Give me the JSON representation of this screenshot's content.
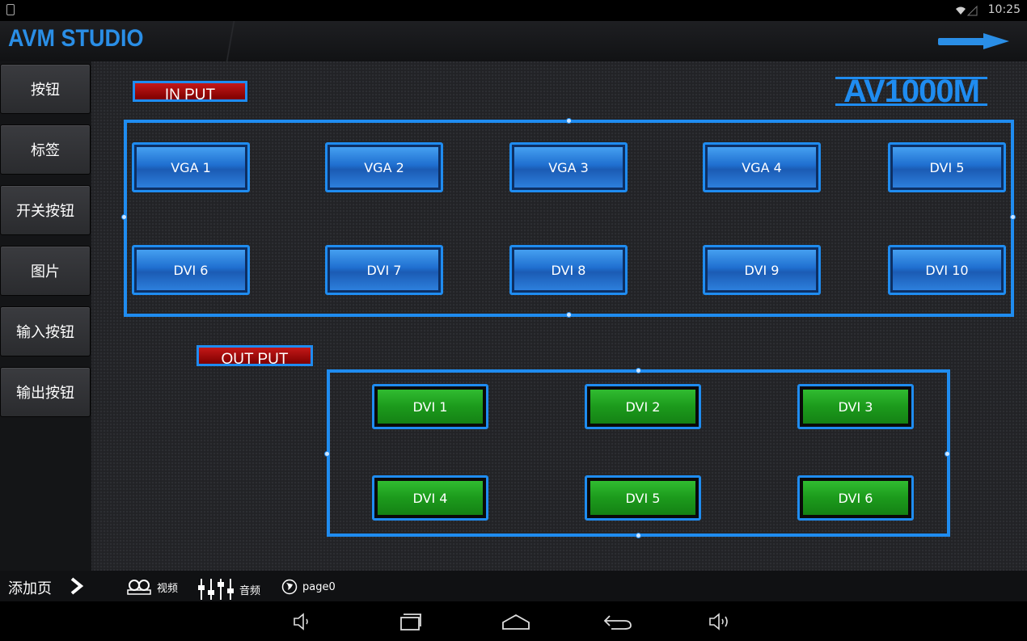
{
  "status_bar": {
    "time": "10:25"
  },
  "app": {
    "title": "AVM STUDIO"
  },
  "sidebar": {
    "items": [
      {
        "label": "按钮"
      },
      {
        "label": "标签"
      },
      {
        "label": "开关按钮"
      },
      {
        "label": "图片"
      },
      {
        "label": "输入按钮"
      },
      {
        "label": "输出按钮"
      }
    ]
  },
  "canvas": {
    "input_label": "IN PUT",
    "output_label": "OUT PUT",
    "brand": "AV1000M",
    "inputs": [
      "VGA 1",
      "VGA 2",
      "VGA 3",
      "VGA 4",
      "DVI 5",
      "DVI 6",
      "DVI 7",
      "DVI 8",
      "DVI 9",
      "DVI 10"
    ],
    "outputs": [
      "DVI 1",
      "DVI 2",
      "DVI 3",
      "DVI 4",
      "DVI 5",
      "DVI 6"
    ]
  },
  "page_bar": {
    "add_page": "添加页",
    "video": "视频",
    "audio": "音频",
    "page": "page0"
  },
  "colors": {
    "accent": "#1f8cf0",
    "input_button": "#1f6fd0",
    "output_button": "#1c9a1c",
    "label": "#c41818"
  }
}
